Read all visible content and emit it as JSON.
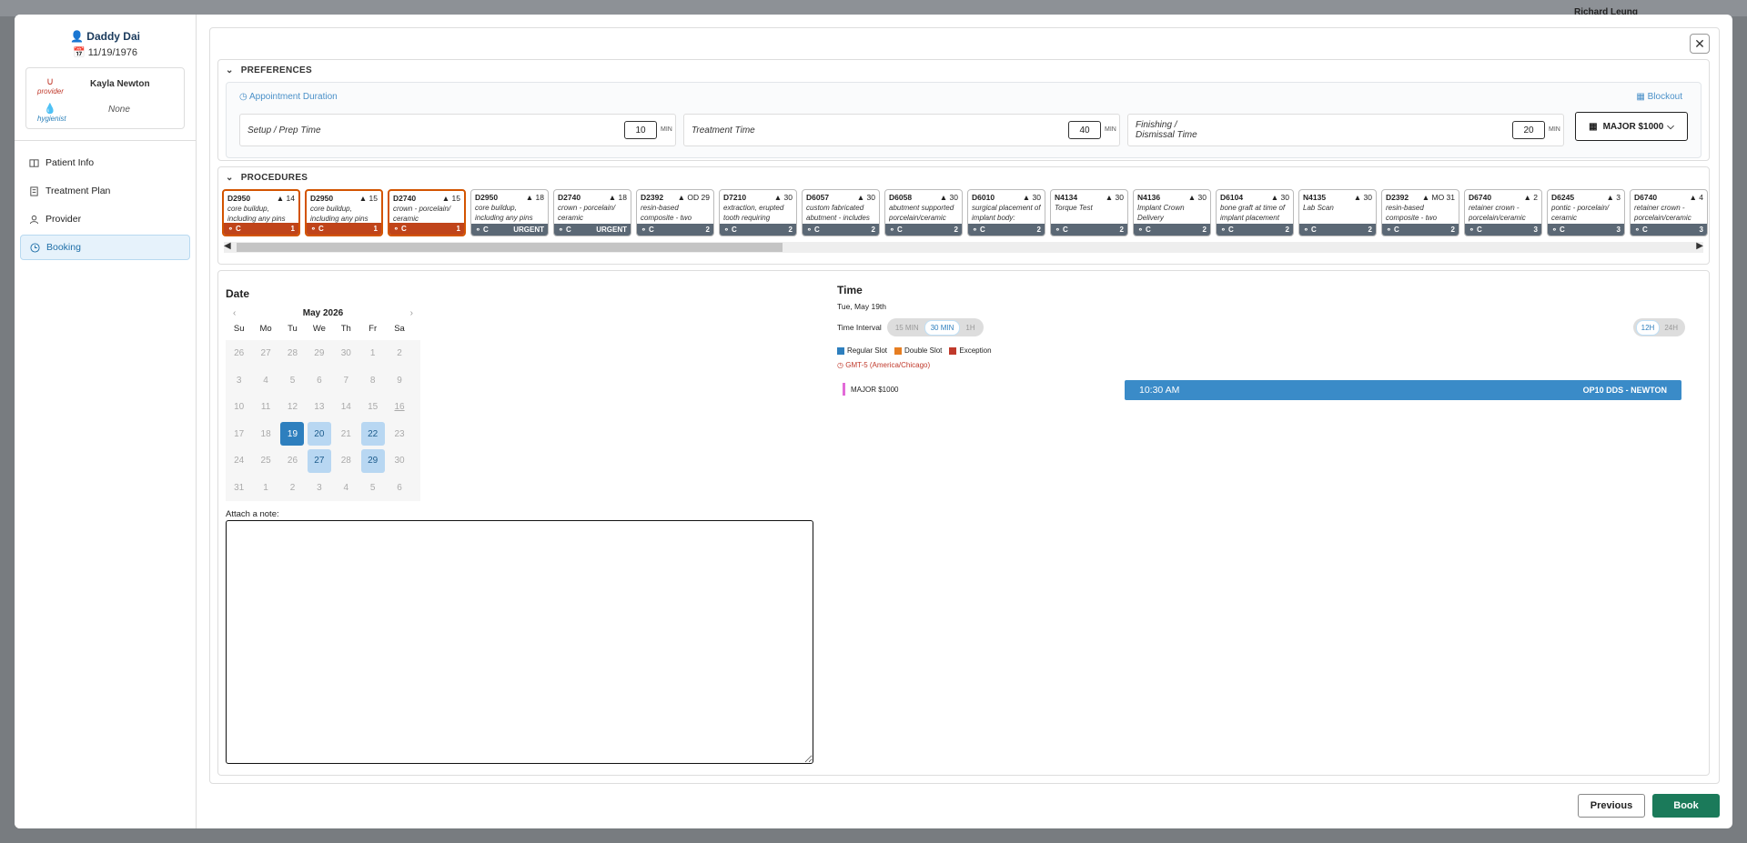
{
  "background": {
    "user_name": "Richard Leung"
  },
  "patient": {
    "name": "Daddy Dai",
    "dob": "11/19/1976"
  },
  "care_team": {
    "provider_role": "provider",
    "provider_name": "Kayla Newton",
    "hygienist_role": "hygienist",
    "hygienist_name": "None"
  },
  "nav": [
    {
      "label": "Patient Info"
    },
    {
      "label": "Treatment Plan"
    },
    {
      "label": "Provider"
    },
    {
      "label": "Booking",
      "active": true
    }
  ],
  "preferences": {
    "header": "PREFERENCES",
    "appointment_duration": "Appointment Duration",
    "blockout": "Blockout",
    "setup_label": "Setup / Prep Time",
    "setup_value": "10",
    "setup_unit": "MIN",
    "treatment_label": "Treatment Time",
    "treatment_value": "40",
    "treatment_unit": "MIN",
    "finish_label_1": "Finishing /",
    "finish_label_2": "Dismissal Time",
    "finish_value": "20",
    "finish_unit": "MIN",
    "major_button": "MAJOR $1000"
  },
  "procedures": {
    "header": "PROCEDURES",
    "items": [
      {
        "code": "D2950",
        "num": "14",
        "desc": "core buildup, including any pins",
        "left": "C",
        "right": "1",
        "selected": true
      },
      {
        "code": "D2950",
        "num": "15",
        "desc": "core buildup, including any pins",
        "left": "C",
        "right": "1",
        "selected": true
      },
      {
        "code": "D2740",
        "num": "15",
        "desc": "crown - porcelain/ ceramic",
        "left": "C",
        "right": "1",
        "selected": true
      },
      {
        "code": "D2950",
        "num": "18",
        "desc": "core buildup, including any pins",
        "left": "C",
        "right": "URGENT",
        "selected": false
      },
      {
        "code": "D2740",
        "num": "18",
        "desc": "crown - porcelain/ ceramic",
        "left": "C",
        "right": "URGENT",
        "selected": false
      },
      {
        "code": "D2392",
        "num": "OD 29",
        "desc": "resin-based composite - two",
        "left": "C",
        "right": "2",
        "selected": false
      },
      {
        "code": "D7210",
        "num": "30",
        "desc": "extraction, erupted tooth requiring",
        "left": "C",
        "right": "2",
        "selected": false
      },
      {
        "code": "D6057",
        "num": "30",
        "desc": "custom fabricated abutment - includes",
        "left": "C",
        "right": "2",
        "selected": false
      },
      {
        "code": "D6058",
        "num": "30",
        "desc": "abutment supported porcelain/ceramic",
        "left": "C",
        "right": "2",
        "selected": false
      },
      {
        "code": "D6010",
        "num": "30",
        "desc": "surgical placement of implant body:",
        "left": "C",
        "right": "2",
        "selected": false
      },
      {
        "code": "N4134",
        "num": "30",
        "desc": "Torque Test",
        "left": "C",
        "right": "2",
        "selected": false
      },
      {
        "code": "N4136",
        "num": "30",
        "desc": "Implant Crown Delivery",
        "left": "C",
        "right": "2",
        "selected": false
      },
      {
        "code": "D6104",
        "num": "30",
        "desc": "bone graft at time of implant placement",
        "left": "C",
        "right": "2",
        "selected": false
      },
      {
        "code": "N4135",
        "num": "30",
        "desc": "Lab Scan",
        "left": "C",
        "right": "2",
        "selected": false
      },
      {
        "code": "D2392",
        "num": "MO 31",
        "desc": "resin-based composite - two",
        "left": "C",
        "right": "2",
        "selected": false
      },
      {
        "code": "D6740",
        "num": "2",
        "desc": "retainer crown - porcelain/ceramic",
        "left": "C",
        "right": "3",
        "selected": false
      },
      {
        "code": "D6245",
        "num": "3",
        "desc": "pontic - porcelain/ ceramic",
        "left": "C",
        "right": "3",
        "selected": false
      },
      {
        "code": "D6740",
        "num": "4",
        "desc": "retainer crown - porcelain/ceramic",
        "left": "C",
        "right": "3",
        "selected": false
      }
    ]
  },
  "date": {
    "header": "Date",
    "month": "May 2026",
    "dow": [
      "Su",
      "Mo",
      "Tu",
      "We",
      "Th",
      "Fr",
      "Sa"
    ],
    "days": [
      {
        "d": "26"
      },
      {
        "d": "27"
      },
      {
        "d": "28"
      },
      {
        "d": "29"
      },
      {
        "d": "30"
      },
      {
        "d": "1"
      },
      {
        "d": "2"
      },
      {
        "d": "3"
      },
      {
        "d": "4"
      },
      {
        "d": "5"
      },
      {
        "d": "6"
      },
      {
        "d": "7"
      },
      {
        "d": "8"
      },
      {
        "d": "9"
      },
      {
        "d": "10"
      },
      {
        "d": "11"
      },
      {
        "d": "12"
      },
      {
        "d": "13"
      },
      {
        "d": "14"
      },
      {
        "d": "15"
      },
      {
        "d": "16",
        "ul": true
      },
      {
        "d": "17"
      },
      {
        "d": "18"
      },
      {
        "d": "19",
        "state": "sel"
      },
      {
        "d": "20",
        "state": "av"
      },
      {
        "d": "21"
      },
      {
        "d": "22",
        "state": "av"
      },
      {
        "d": "23"
      },
      {
        "d": "24"
      },
      {
        "d": "25"
      },
      {
        "d": "26"
      },
      {
        "d": "27",
        "state": "av"
      },
      {
        "d": "28"
      },
      {
        "d": "29",
        "state": "av"
      },
      {
        "d": "30"
      },
      {
        "d": "31"
      },
      {
        "d": "1"
      },
      {
        "d": "2"
      },
      {
        "d": "3"
      },
      {
        "d": "4"
      },
      {
        "d": "5"
      },
      {
        "d": "6"
      }
    ],
    "note_label": "Attach a note:"
  },
  "time": {
    "header": "Time",
    "selected_date": "Tue, May 19th",
    "interval_label": "Time Interval",
    "intervals": [
      "15 MIN",
      "30 MIN",
      "1H"
    ],
    "interval_selected": "30 MIN",
    "formats": [
      "12H",
      "24H"
    ],
    "format_selected": "12H",
    "legend": [
      {
        "label": "Regular Slot",
        "color": "#2e7fbe"
      },
      {
        "label": "Double Slot",
        "color": "#e67e22"
      },
      {
        "label": "Exception",
        "color": "#c0392b"
      }
    ],
    "timezone": "GMT-5 (America/Chicago)",
    "lane_label": "MAJOR $1000",
    "slot_time": "10:30 AM",
    "slot_op": "OP10 DDS - NEWTON"
  },
  "footer": {
    "previous": "Previous",
    "book": "Book"
  }
}
